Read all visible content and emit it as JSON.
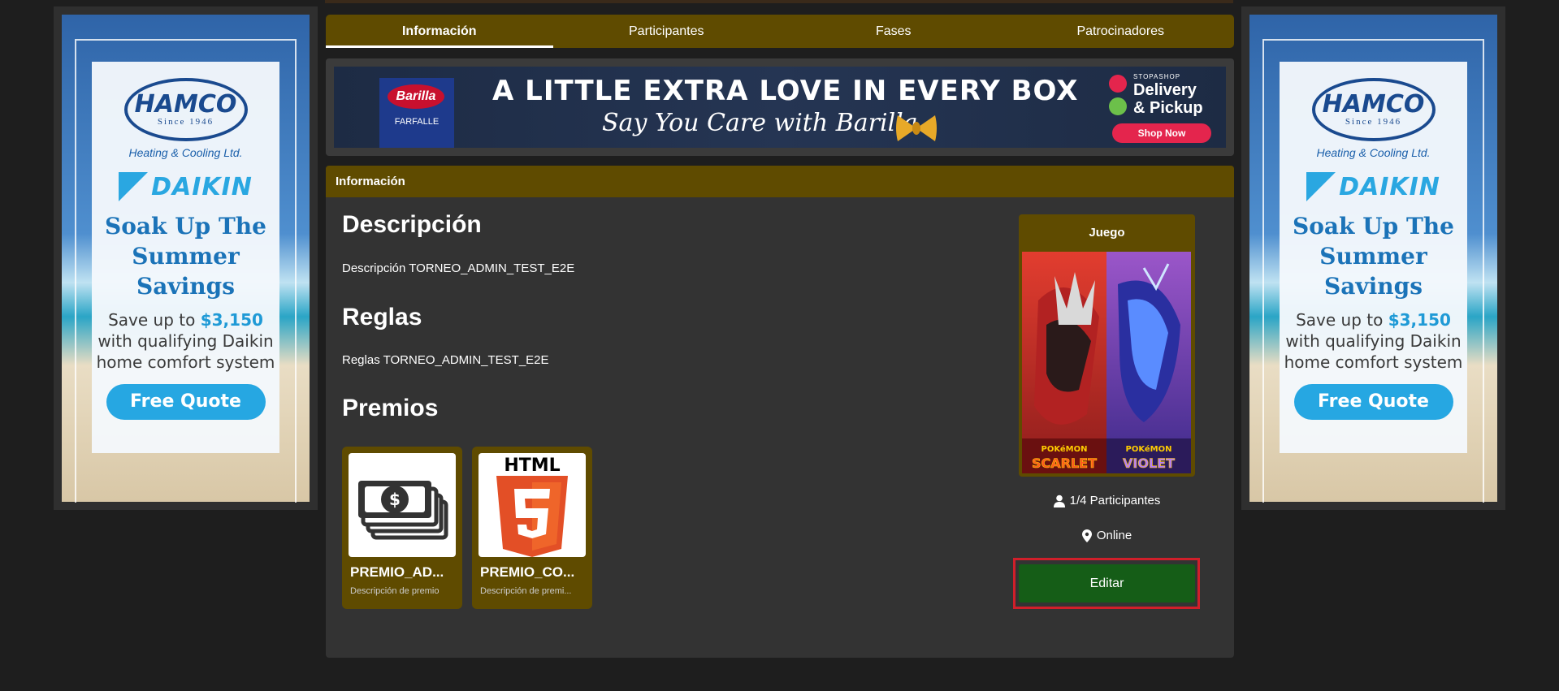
{
  "tabs": [
    "Información",
    "Participantes",
    "Fases",
    "Patrocinadores"
  ],
  "active_tab": 0,
  "side_ad": {
    "brand": "HAMCO",
    "since": "Since 1946",
    "tagline": "Heating & Cooling Ltd.",
    "partner": "DAIKIN",
    "headline": "Soak Up The Summer Savings",
    "offer_prefix": "Save up to",
    "offer_amount": "$3,150",
    "offer_suffix": "with qualifying Daikin home comfort system",
    "cta": "Free Quote"
  },
  "banner": {
    "brand": "Barilla",
    "product": "FARFALLE",
    "headline": "A LITTLE EXTRA LOVE IN EVERY BOX",
    "subline": "Say You Care with Barilla",
    "store_small": "STOPASHOP",
    "store_line1": "Delivery",
    "store_line2": "& Pickup",
    "cta": "Shop Now"
  },
  "info": {
    "header": "Información",
    "description_title": "Descripción",
    "description_text": "Descripción TORNEO_ADMIN_TEST_E2E",
    "rules_title": "Reglas",
    "rules_text": "Reglas TORNEO_ADMIN_TEST_E2E",
    "prizes_title": "Premios",
    "prizes": [
      {
        "name": "PREMIO_AD...",
        "description": "Descripción de premio",
        "icon": "money-icon"
      },
      {
        "name": "PREMIO_CO...",
        "description": "Descripción de premi...",
        "icon": "html5-icon",
        "icon_text": "HTML"
      }
    ]
  },
  "game": {
    "label": "Juego",
    "cover_left": "SCARLET",
    "cover_right": "VIOLET",
    "cover_brand": "POKéMON",
    "participants": "1/4 Participantes",
    "location": "Online",
    "edit_label": "Editar"
  },
  "colors": {
    "accent": "#5f4b00",
    "edit_button": "#155d17",
    "highlight_outline": "#d01f2a",
    "card_bg": "#333333",
    "page_bg": "#1e1e1e"
  }
}
